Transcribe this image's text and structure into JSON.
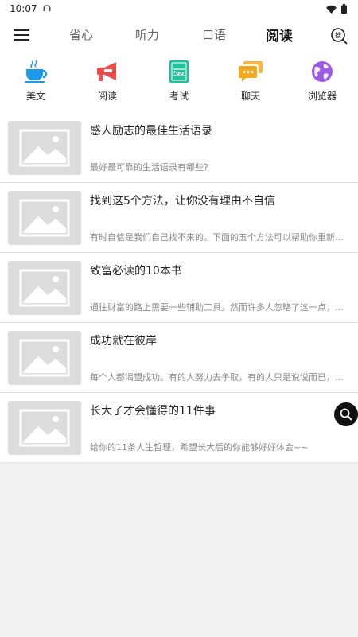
{
  "status": {
    "time": "10:07"
  },
  "nav": {
    "tabs": [
      {
        "label": "省心"
      },
      {
        "label": "听力"
      },
      {
        "label": "口语"
      },
      {
        "label": "阅读"
      }
    ],
    "active_tab": "阅读",
    "search_icon_glyph": "搜"
  },
  "categories": [
    {
      "label": "美文",
      "icon": "coffee-cup-icon",
      "color": "#1e9ae8"
    },
    {
      "label": "阅读",
      "icon": "megaphone-icon",
      "color": "#ee4b4b"
    },
    {
      "label": "考试",
      "icon": "score-book-icon",
      "color": "#22c19a"
    },
    {
      "label": "聊天",
      "icon": "chat-bubbles-icon",
      "color": "#f2a91f"
    },
    {
      "label": "浏览器",
      "icon": "globe-icon",
      "color": "#9b59e6"
    }
  ],
  "articles": [
    {
      "title": "感人励志的最佳生活语录",
      "desc": "最好最可靠的生活语录有哪些?"
    },
    {
      "title": "找到这5个方法，让你没有理由不自信",
      "desc": "有时自信是我们自己找不来的。下面的五个方法可以帮助你重新找回自信"
    },
    {
      "title": "致富必读的10本书",
      "desc": "通往财富的路上需要一些辅助工具。然而许多人忽略了这一点，错过了很多"
    },
    {
      "title": "成功就在彼岸",
      "desc": "每个人都渴望成功。有的人努力去争取，有的人只是说说而已，什么都不做"
    },
    {
      "title": "长大了才会懂得的11件事",
      "desc": "给你的11条人生哲理，希望长大后的你能够好好体会~~"
    }
  ],
  "theme": {
    "accent": "#111111",
    "divider": "#e2e2e2",
    "placeholder": "#dcdcdc"
  }
}
